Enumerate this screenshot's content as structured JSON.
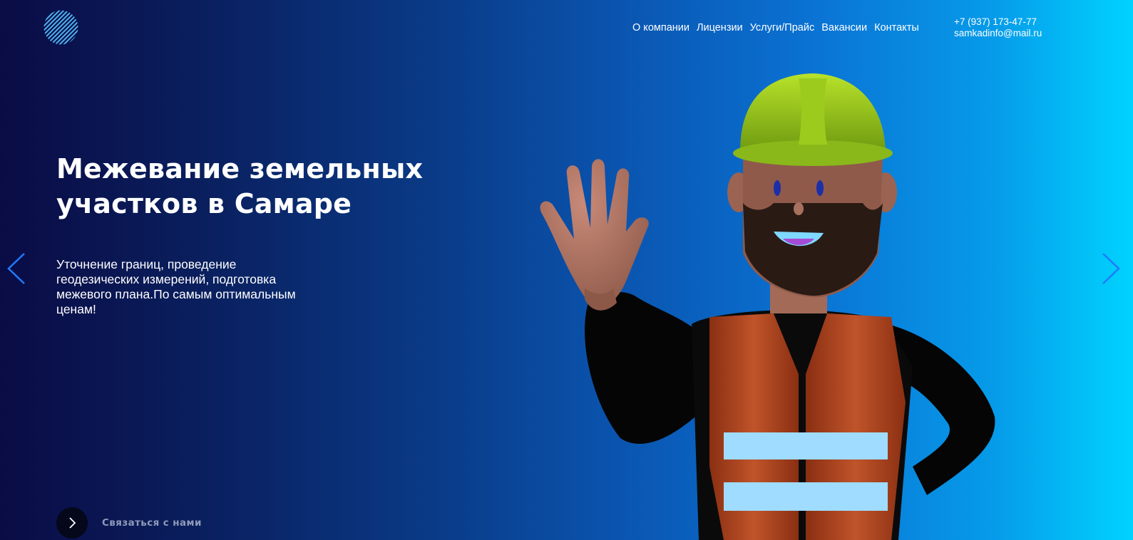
{
  "header": {
    "logo_icon": "striped-circle-logo",
    "nav": [
      {
        "label": "О компании"
      },
      {
        "label": "Лицензии"
      },
      {
        "label": "Услуги/Прайс"
      },
      {
        "label": "Вакансии"
      },
      {
        "label": "Контакты"
      }
    ],
    "contacts": {
      "phone": "+7 (937) 173-47-77",
      "email": "samkadinfo@mail.ru"
    }
  },
  "hero": {
    "title_line1": "Межевание земельных",
    "title_line2": "участков в Самаре",
    "subtitle": "Уточнение границ, проведение геодезических измерений, подготовка межевого плана.По самым оптимальным ценам!",
    "cta_label": "Связаться с нами",
    "cta_icon": "chevron-right-icon",
    "illustration": "waving-construction-worker"
  },
  "slider": {
    "prev_icon": "chevron-left-icon",
    "next_icon": "chevron-right-icon"
  },
  "colors": {
    "gradient_start": "#0a0c45",
    "gradient_end": "#00d3fe",
    "arrow": "#1f7bff",
    "cta_circle": "#05071a",
    "cta_text": "#8e9ab8",
    "helmet": "#a6d21e",
    "vest": "#b2461e"
  }
}
